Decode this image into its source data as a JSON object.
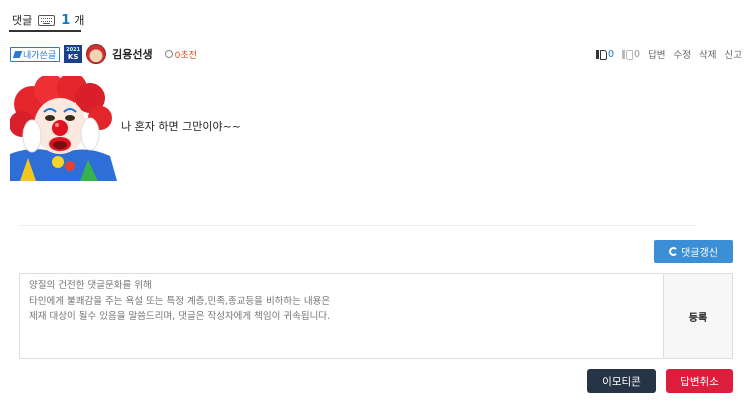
{
  "tab": {
    "label": "댓글",
    "count": "1",
    "unit": "개"
  },
  "comment": {
    "mine_badge": "내가쓴글",
    "level_badge": {
      "year": "2021",
      "text": "KS"
    },
    "author": "김용선생",
    "time": "0초전",
    "likes": "0",
    "dislikes": "0",
    "actions": [
      "답변",
      "수정",
      "삭제",
      "신고"
    ],
    "text": "나 혼자 하면 그만이야~~"
  },
  "refresh_label": "댓글갱신",
  "form": {
    "placeholder": "양질의 건전한 댓글문화를 위해\n타인에게 불쾌감을 주는 욕설 또는 특정 계층,민족,종교등을 비하하는 내용은\n제재 대상이 될수 있음을 말씀드리며, 댓글은 작성자에게 책임이 귀속됩니다.",
    "submit_label": "등록"
  },
  "buttons": {
    "emoticon": "이모티콘",
    "cancel_reply": "답변취소"
  },
  "colors": {
    "accent": "#3a8fd6",
    "dark": "#263446",
    "danger": "#dc1e3c",
    "time": "#e05020"
  }
}
